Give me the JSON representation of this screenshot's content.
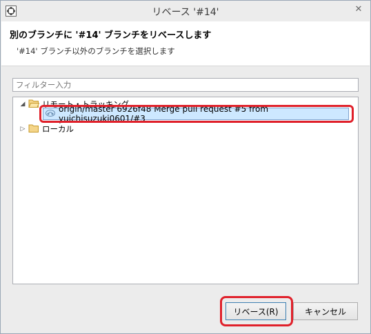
{
  "window": {
    "title": "リベース '#14'"
  },
  "header": {
    "title": "別のブランチに '#14' ブランチをリベースします",
    "subtitle": "'#14' ブランチ以外のブランチを選択します"
  },
  "filter": {
    "placeholder": "フィルター入力"
  },
  "tree": {
    "remote_label": "リモート・トラッキング",
    "selected_ref": "origin/master 6926f48 Merge pull request #5 from yuichisuzuki0601/#3",
    "local_label": "ローカル"
  },
  "buttons": {
    "rebase_label": "リベース(R)",
    "cancel_label": "キャンセル"
  },
  "colors": {
    "highlight": "#e0202a",
    "selection_bg": "#cde8ff",
    "selection_border": "#7da2ce"
  }
}
